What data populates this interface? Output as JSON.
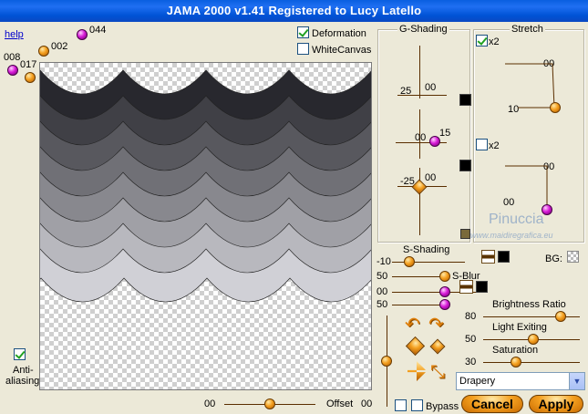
{
  "window": {
    "title": "JAMA 2000   v1.41  Registered to Lucy Latello"
  },
  "links": {
    "help": "help"
  },
  "presets": [
    {
      "label": "044",
      "color": "purple"
    },
    {
      "label": "002",
      "color": "orange"
    },
    {
      "label": "008",
      "color": "purple"
    },
    {
      "label": "017",
      "color": "orange"
    }
  ],
  "options": {
    "deformation": {
      "label": "Deformation",
      "checked": true
    },
    "white_canvas": {
      "label": "WhiteCanvas",
      "checked": false
    },
    "anti_aliasing": {
      "label1": "Anti-",
      "label2": "aliasing",
      "checked": true
    },
    "bypass": {
      "label": "Bypass",
      "checked": false
    }
  },
  "g_shading": {
    "title": "G-Shading",
    "row1": {
      "left": "25",
      "right": "00"
    },
    "row2": {
      "left": "00",
      "right": "15"
    },
    "row3": {
      "left": "-25",
      "right": "00"
    }
  },
  "stretch": {
    "title": "Stretch",
    "top": {
      "label": "x2",
      "checked": true,
      "top_value": "00",
      "left_value": "10"
    },
    "bottom": {
      "label": "x2",
      "checked": false,
      "top_value": "00",
      "left_value": "00"
    }
  },
  "watermark": {
    "name": "Pinuccia",
    "site": "www.maidiregrafica.eu"
  },
  "s_shading": {
    "label": "S-Shading",
    "value": "-10"
  },
  "bg": {
    "label": "BG:"
  },
  "s_blur": {
    "label": "S-Blur",
    "value": "50"
  },
  "extra_sliders": [
    {
      "value": "00"
    },
    {
      "value": "50"
    }
  ],
  "brightness": {
    "label": "Brightness Ratio",
    "value": "80"
  },
  "light_exiting": {
    "label": "Light Exiting",
    "value": "50"
  },
  "saturation": {
    "label": "Saturation",
    "value": "30"
  },
  "style_select": {
    "value": "Drapery"
  },
  "offset": {
    "left": "00",
    "label": "Offset",
    "right": "00"
  },
  "buttons": {
    "cancel": "Cancel",
    "apply": "Apply"
  }
}
